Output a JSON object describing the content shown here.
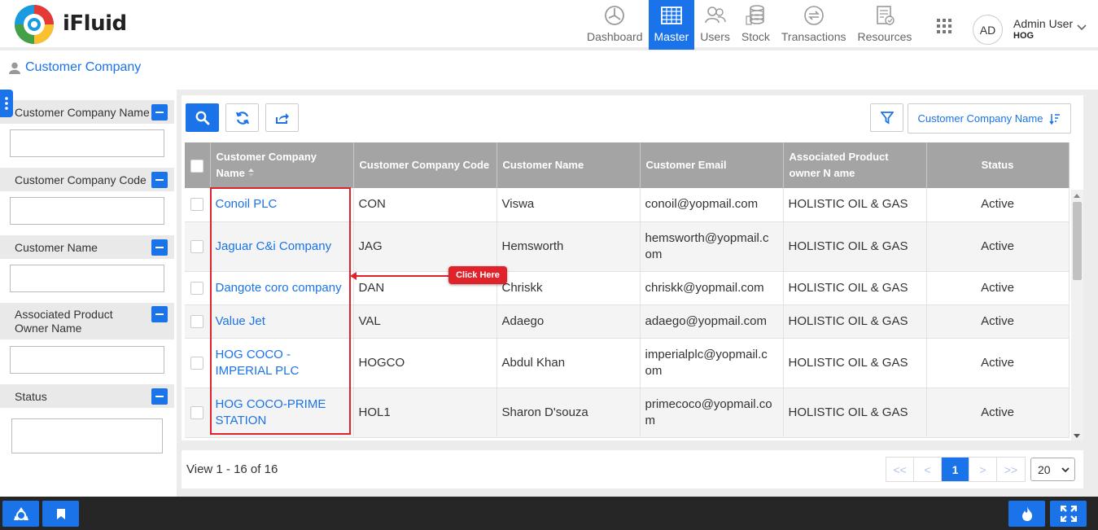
{
  "app": {
    "name": "iFluid"
  },
  "nav": [
    {
      "label": "Dashboard",
      "icon": "dashboard-icon"
    },
    {
      "label": "Master",
      "icon": "master-icon",
      "active": true
    },
    {
      "label": "Users",
      "icon": "users-icon"
    },
    {
      "label": "Stock",
      "icon": "stock-icon"
    },
    {
      "label": "Transactions",
      "icon": "transactions-icon"
    },
    {
      "label": "Resources",
      "icon": "resources-icon"
    }
  ],
  "user": {
    "initials": "AD",
    "name": "Admin User",
    "org": "HOG"
  },
  "breadcrumb": {
    "label": "Customer Company"
  },
  "filters": [
    {
      "label": "Customer Company Name"
    },
    {
      "label": "Customer Company Code"
    },
    {
      "label": "Customer Name"
    },
    {
      "label": "Associated Product Owner Name"
    },
    {
      "label": "Status"
    }
  ],
  "toolbar": {
    "sort_label": "Customer Company Name"
  },
  "table": {
    "columns": [
      "Customer Company Name",
      "Customer Company Code",
      "Customer Name",
      "Customer Email",
      "Associated Product owner N ame",
      "Status"
    ],
    "rows": [
      [
        "Conoil PLC",
        "CON",
        "Viswa",
        "conoil@yopmail.com",
        "HOLISTIC OIL & GAS",
        "Active"
      ],
      [
        "Jaguar C&i Company",
        "JAG",
        "Hemsworth",
        "hemsworth@yopmail.c om",
        "HOLISTIC OIL & GAS",
        "Active"
      ],
      [
        "Dangote coro company",
        "DAN",
        "Chriskk",
        "chriskk@yopmail.com",
        "HOLISTIC OIL & GAS",
        "Active"
      ],
      [
        "Value Jet",
        "VAL",
        "Adaego",
        "adaego@yopmail.com",
        "HOLISTIC OIL & GAS",
        "Active"
      ],
      [
        "HOG COCO - IMPERIAL PLC",
        "HOGCO",
        "Abdul Khan",
        "imperialplc@yopmail.c om",
        "HOLISTIC OIL & GAS",
        "Active"
      ],
      [
        "HOG COCO-PRIME STATION",
        "HOL1",
        "Sharon D'souza",
        "primecoco@yopmail.co m",
        "HOLISTIC OIL & GAS",
        "Active"
      ]
    ]
  },
  "annotation": {
    "label": "Click Here"
  },
  "pagination": {
    "view_text": "View 1 - 16 of 16",
    "current_page": "1",
    "page_size": "20",
    "first": "<<",
    "prev": "<",
    "next": ">",
    "last": ">>"
  },
  "colors": {
    "accent": "#1a73e8",
    "header_gray": "#a4a4a4",
    "annotation_red": "#e0232b"
  }
}
